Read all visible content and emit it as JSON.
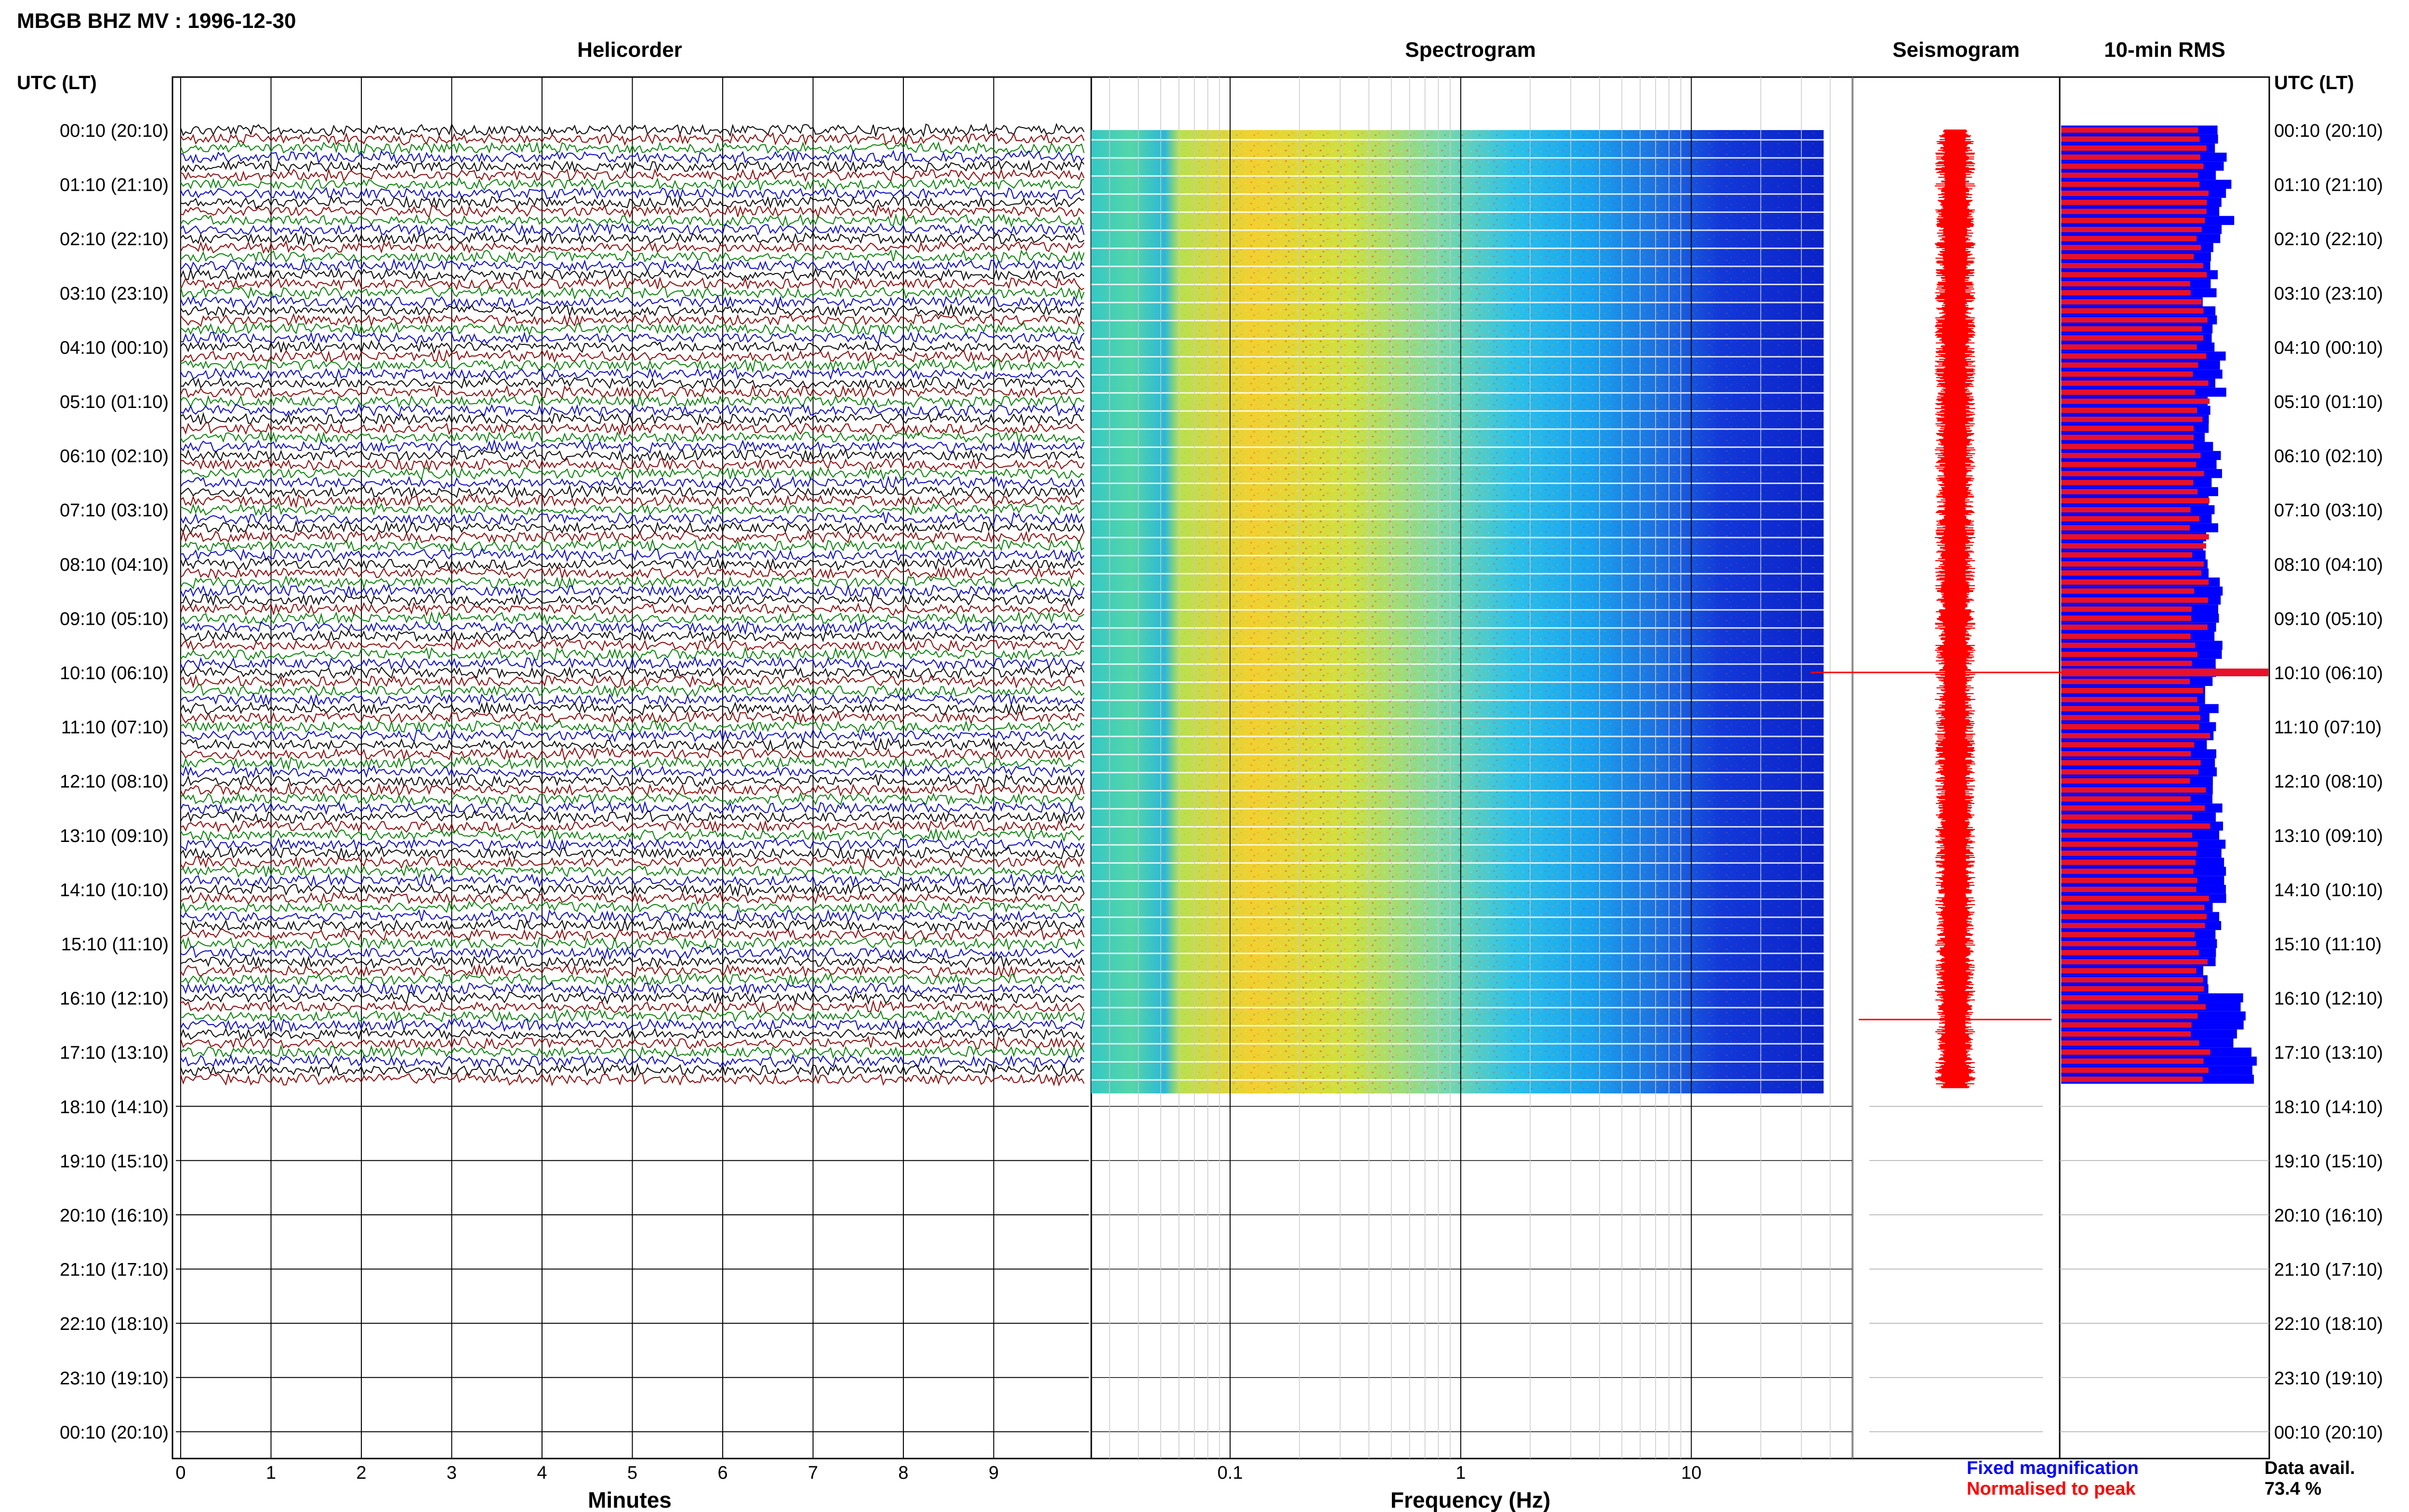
{
  "header": {
    "title": "MBGB BHZ MV : 1996-12-30",
    "utc_label_left": "UTC (LT)",
    "utc_label_right": "UTC (LT)"
  },
  "panels": {
    "helicorder": "Helicorder",
    "spectrogram": "Spectrogram",
    "seismogram": "Seismogram",
    "rms": "10-min RMS"
  },
  "axes": {
    "helicorder_xlabel": "Minutes",
    "spectrogram_xlabel": "Frequency (Hz)"
  },
  "legend": {
    "fixed": "Fixed magnification",
    "normalised": "Normalised to peak",
    "fixed_color": "#0000ff",
    "normalised_color": "#ff0000"
  },
  "availability": {
    "label": "Data avail.",
    "value": "73.4 %"
  },
  "colors": {
    "trace_cycle": [
      "#000000",
      "#8b0000",
      "#008000",
      "#0000cc"
    ],
    "seismogram": "#ff0000",
    "rms_fixed": "#0000ff",
    "rms_norm": "#e8102a"
  },
  "chart_data": {
    "type": "heatmap",
    "station": "MBGB BHZ MV",
    "date": "1996-12-30",
    "row_labels": [
      "00:10 (20:10)",
      "01:10 (21:10)",
      "02:10 (22:10)",
      "03:10 (23:10)",
      "04:10 (00:10)",
      "05:10 (01:10)",
      "06:10 (02:10)",
      "07:10 (03:10)",
      "08:10 (04:10)",
      "09:10 (05:10)",
      "10:10 (06:10)",
      "11:10 (07:10)",
      "12:10 (08:10)",
      "13:10 (09:10)",
      "14:10 (10:10)",
      "15:10 (11:10)",
      "16:10 (12:10)",
      "17:10 (13:10)",
      "18:10 (14:10)",
      "19:10 (15:10)",
      "20:10 (16:10)",
      "21:10 (17:10)",
      "22:10 (18:10)",
      "23:10 (19:10)",
      "00:10 (20:10)"
    ],
    "helicorder_x_ticks": [
      0,
      1,
      2,
      3,
      4,
      5,
      6,
      7,
      8,
      9
    ],
    "helicorder_x_range": [
      0,
      10
    ],
    "spectrogram_x_ticks": [
      "0.1",
      "1",
      "10"
    ],
    "spectrogram_x_range": [
      0.025,
      50
    ],
    "spectrogram_scale": "log",
    "data_rows_per_hour": 6,
    "data_end_hour": 17.67,
    "rms_fixed_levels": [
      0.78,
      0.8,
      0.74,
      0.72,
      0.76,
      0.7,
      0.74,
      0.72,
      0.74,
      0.76,
      0.72,
      0.74,
      0.76,
      0.78,
      0.76,
      0.72,
      0.86,
      0.92
    ]
  }
}
